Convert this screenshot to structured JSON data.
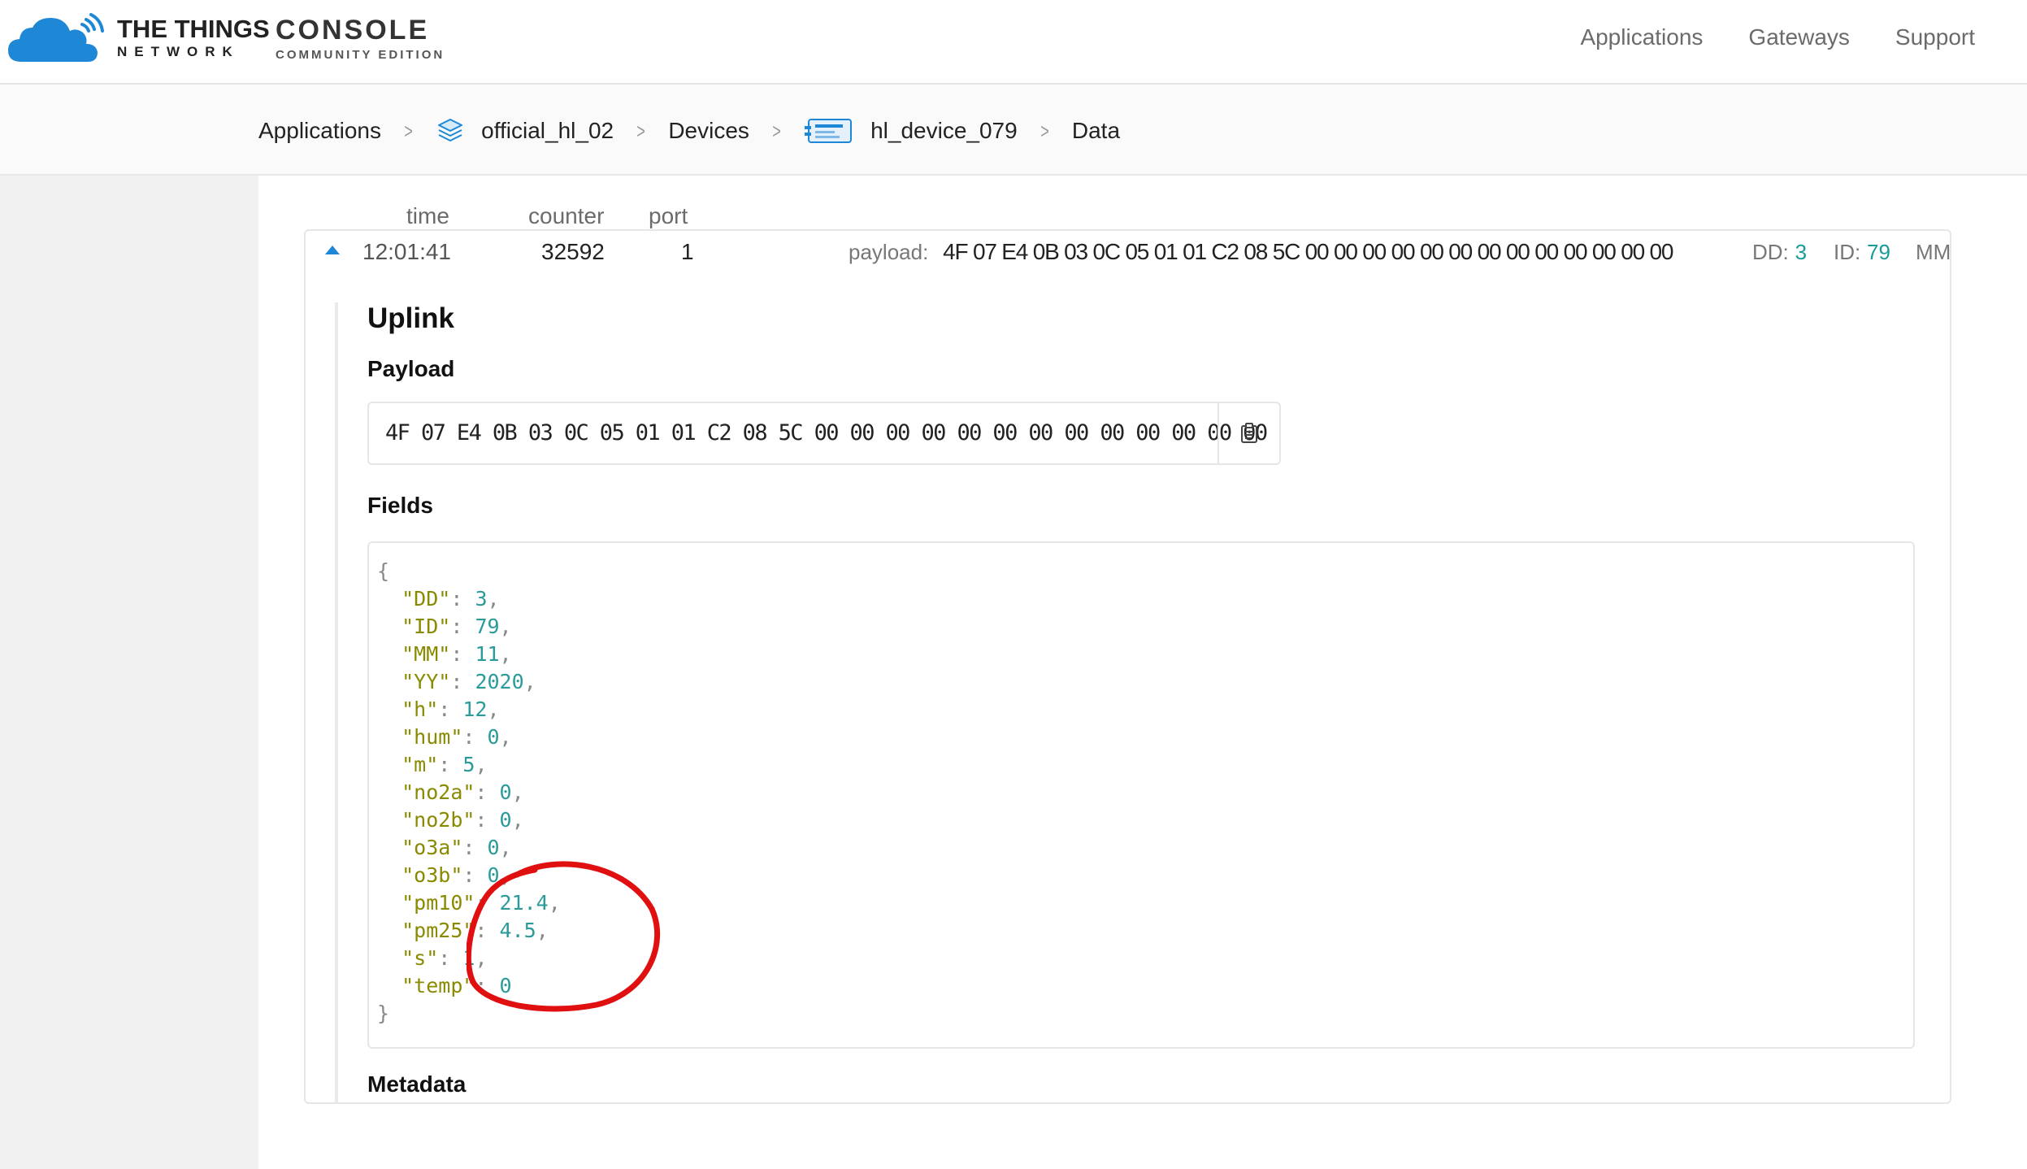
{
  "header": {
    "brand_top": "THE THINGS",
    "brand_bottom": "NETWORK",
    "console_title": "CONSOLE",
    "console_subtitle": "COMMUNITY EDITION",
    "nav": [
      "Applications",
      "Gateways",
      "Support"
    ]
  },
  "breadcrumb": {
    "items": [
      "Applications",
      "official_hl_02",
      "Devices",
      "hl_device_079",
      "Data"
    ]
  },
  "table": {
    "headers": [
      "time",
      "counter",
      "port"
    ],
    "row": {
      "time": "12:01:41",
      "counter": "32592",
      "port": "1",
      "payload_label": "payload:",
      "payload": "4F 07 E4 0B 03 0C 05 01 01 C2 08 5C 00 00 00 00 00 00 00 00 00 00 00 00 00",
      "tags": [
        {
          "key": "DD:",
          "value": "3"
        },
        {
          "key": "ID:",
          "value": "79"
        },
        {
          "key": "MM",
          "value": ""
        }
      ]
    }
  },
  "detail": {
    "title": "Uplink",
    "payload_heading": "Payload",
    "payload_value": "4F 07 E4 0B 03 0C 05 01 01 C2 08 5C 00 00 00 00 00 00 00 00 00 00 00 00 00",
    "fields_heading": "Fields",
    "fields": [
      {
        "key": "\"DD\"",
        "value": "3"
      },
      {
        "key": "\"ID\"",
        "value": "79"
      },
      {
        "key": "\"MM\"",
        "value": "11"
      },
      {
        "key": "\"YY\"",
        "value": "2020"
      },
      {
        "key": "\"h\"",
        "value": "12"
      },
      {
        "key": "\"hum\"",
        "value": "0"
      },
      {
        "key": "\"m\"",
        "value": "5"
      },
      {
        "key": "\"no2a\"",
        "value": "0"
      },
      {
        "key": "\"no2b\"",
        "value": "0"
      },
      {
        "key": "\"o3a\"",
        "value": "0"
      },
      {
        "key": "\"o3b\"",
        "value": "0"
      },
      {
        "key": "\"pm10\"",
        "value": "21.4"
      },
      {
        "key": "\"pm25\"",
        "value": "4.5"
      },
      {
        "key": "\"s\"",
        "value": "1"
      },
      {
        "key": "\"temp\"",
        "value": "0"
      }
    ],
    "metadata_heading": "Metadata"
  },
  "colors": {
    "accent": "#1e88d6",
    "value_teal": "#2a9a9a",
    "key_olive": "#8a8a00",
    "annotation_red": "#e01010"
  },
  "icons": {
    "logo": "ttn-cloud-icon",
    "application": "stack-layers-icon",
    "device": "device-card-icon",
    "copy": "clipboard-icon",
    "expand": "caret-up-icon"
  }
}
